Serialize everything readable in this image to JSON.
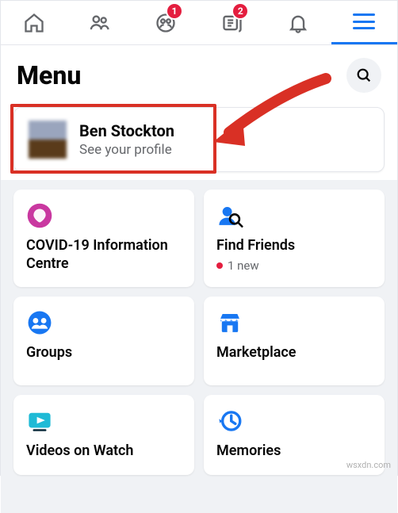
{
  "nav": {
    "badges": {
      "groups": "1",
      "news": "2"
    }
  },
  "header": {
    "title": "Menu"
  },
  "profile": {
    "name": "Ben Stockton",
    "subtitle": "See your profile",
    "avatar_colors": {
      "top": "#9aa5bd",
      "bottom": "#5a3b1a"
    }
  },
  "tiles": [
    {
      "icon": "covid-icon",
      "label": "COVID-19 Information Centre",
      "sub": ""
    },
    {
      "icon": "find-friends-icon",
      "label": "Find Friends",
      "sub": "1 new",
      "sub_has_dot": true
    },
    {
      "icon": "groups-icon",
      "label": "Groups",
      "sub": ""
    },
    {
      "icon": "marketplace-icon",
      "label": "Marketplace",
      "sub": ""
    },
    {
      "icon": "watch-icon",
      "label": "Videos on Watch",
      "sub": ""
    },
    {
      "icon": "memories-icon",
      "label": "Memories",
      "sub": ""
    }
  ],
  "colors": {
    "accent": "#1877f2",
    "red": "#e41e3f"
  },
  "watermark": "wsxdn.com"
}
